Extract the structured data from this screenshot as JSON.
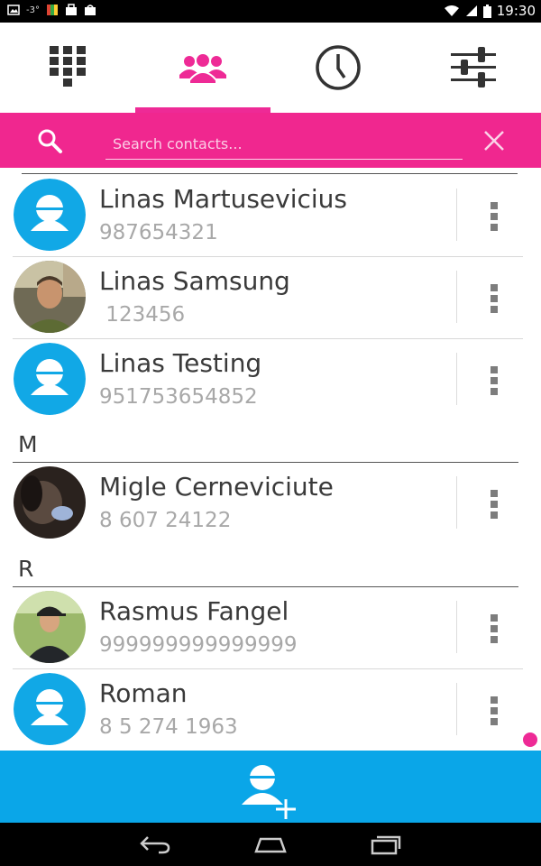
{
  "status_bar": {
    "temp": "-3°",
    "time": "19:30"
  },
  "tabs": [
    {
      "name": "dialpad",
      "icon": "dialpad-icon",
      "active": false
    },
    {
      "name": "contacts",
      "icon": "contacts-icon",
      "active": true
    },
    {
      "name": "history",
      "icon": "clock-icon",
      "active": false
    },
    {
      "name": "settings",
      "icon": "sliders-icon",
      "active": false
    }
  ],
  "search": {
    "placeholder": "Search contacts..."
  },
  "contacts": [
    {
      "name": "Linas Martusevicius",
      "number": "987654321",
      "avatar": "default"
    },
    {
      "name": "Linas Samsung",
      "number": " 123456",
      "avatar": "photo"
    },
    {
      "name": "Linas Testing",
      "number": "951753654852",
      "avatar": "default"
    },
    {
      "section": "M"
    },
    {
      "name": "Migle Cerneviciute",
      "number": "8 607 24122",
      "avatar": "photo"
    },
    {
      "section": "R"
    },
    {
      "name": "Rasmus Fangel",
      "number": "999999999999999",
      "avatar": "photo"
    },
    {
      "name": "Roman",
      "number": "8 5 274 1963",
      "avatar": "default"
    }
  ],
  "sections": {
    "m": "M",
    "r": "R"
  },
  "colors": {
    "accent": "#ee2a96",
    "avatar_blue": "#11a8e6",
    "add_bar": "#0aa6e8"
  }
}
